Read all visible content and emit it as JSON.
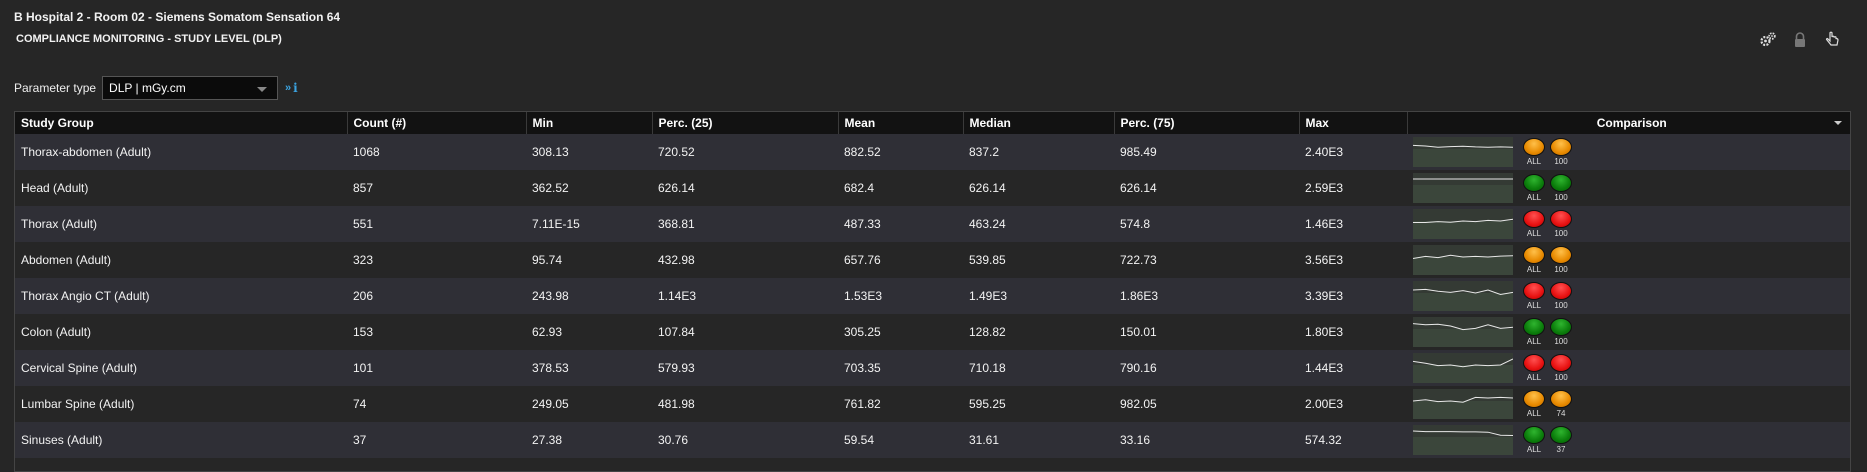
{
  "header": {
    "title": "B Hospital 2 - Room 02 - Siemens Somatom Sensation 64",
    "subtitle": "COMPLIANCE MONITORING - STUDY LEVEL (DLP)"
  },
  "toolbar": {
    "icons": [
      "settings-gears-icon",
      "lock-icon",
      "pointer-hand-icon"
    ]
  },
  "parameter": {
    "label": "Parameter type",
    "selected": "DLP | mGy.cm"
  },
  "table": {
    "columns": [
      "Study Group",
      "Count (#)",
      "Min",
      "Perc. (25)",
      "Mean",
      "Median",
      "Perc. (75)",
      "Max",
      "Comparison"
    ],
    "rows": [
      {
        "group": "Thorax-abdomen (Adult)",
        "count": "1068",
        "min": "308.13",
        "p25": "720.52",
        "mean": "882.52",
        "median": "837.2",
        "p75": "985.49",
        "max": "2.40E3",
        "spark": [
          0.72,
          0.7,
          0.66,
          0.68,
          0.69,
          0.67,
          0.66,
          0.67,
          0.66
        ],
        "lights": [
          {
            "color": "orange",
            "label": "ALL"
          },
          {
            "color": "orange",
            "label": "100"
          }
        ]
      },
      {
        "group": "Head (Adult)",
        "count": "857",
        "min": "362.52",
        "p25": "626.14",
        "mean": "682.4",
        "median": "626.14",
        "p75": "626.14",
        "max": "2.59E3",
        "spark": [
          0.8,
          0.8,
          0.8,
          0.8,
          0.8,
          0.8,
          0.8,
          0.8,
          0.8
        ],
        "lights": [
          {
            "color": "green",
            "label": "ALL"
          },
          {
            "color": "green",
            "label": "100"
          }
        ]
      },
      {
        "group": "Thorax (Adult)",
        "count": "551",
        "min": "7.11E-15",
        "p25": "368.81",
        "mean": "487.33",
        "median": "463.24",
        "p75": "574.8",
        "max": "1.46E3",
        "spark": [
          0.55,
          0.55,
          0.58,
          0.56,
          0.6,
          0.58,
          0.62,
          0.6,
          0.66
        ],
        "lights": [
          {
            "color": "red",
            "label": "ALL"
          },
          {
            "color": "red",
            "label": "100"
          }
        ]
      },
      {
        "group": "Abdomen (Adult)",
        "count": "323",
        "min": "95.74",
        "p25": "432.98",
        "mean": "657.76",
        "median": "539.85",
        "p75": "722.73",
        "max": "3.56E3",
        "spark": [
          0.55,
          0.62,
          0.58,
          0.66,
          0.6,
          0.62,
          0.6,
          0.63,
          0.64
        ],
        "lights": [
          {
            "color": "orange",
            "label": "ALL"
          },
          {
            "color": "orange",
            "label": "100"
          }
        ]
      },
      {
        "group": "Thorax Angio CT (Adult)",
        "count": "206",
        "min": "243.98",
        "p25": "1.14E3",
        "mean": "1.53E3",
        "median": "1.49E3",
        "p75": "1.86E3",
        "max": "3.39E3",
        "spark": [
          0.7,
          0.72,
          0.66,
          0.62,
          0.68,
          0.6,
          0.7,
          0.55,
          0.62
        ],
        "lights": [
          {
            "color": "red",
            "label": "ALL"
          },
          {
            "color": "red",
            "label": "100"
          }
        ]
      },
      {
        "group": "Colon (Adult)",
        "count": "153",
        "min": "62.93",
        "p25": "107.84",
        "mean": "305.25",
        "median": "128.82",
        "p75": "150.01",
        "max": "1.80E3",
        "spark": [
          0.78,
          0.74,
          0.76,
          0.7,
          0.58,
          0.62,
          0.74,
          0.62,
          0.66
        ],
        "lights": [
          {
            "color": "green",
            "label": "ALL"
          },
          {
            "color": "green",
            "label": "100"
          }
        ]
      },
      {
        "group": "Cervical Spine (Adult)",
        "count": "101",
        "min": "378.53",
        "p25": "579.93",
        "mean": "703.35",
        "median": "710.18",
        "p75": "790.16",
        "max": "1.44E3",
        "spark": [
          0.72,
          0.66,
          0.58,
          0.6,
          0.54,
          0.6,
          0.58,
          0.6,
          0.8
        ],
        "lights": [
          {
            "color": "red",
            "label": "ALL"
          },
          {
            "color": "red",
            "label": "100"
          }
        ]
      },
      {
        "group": "Lumbar Spine (Adult)",
        "count": "74",
        "min": "249.05",
        "p25": "481.98",
        "mean": "761.82",
        "median": "595.25",
        "p75": "982.05",
        "max": "2.00E3",
        "spark": [
          0.6,
          0.64,
          0.58,
          0.6,
          0.56,
          0.72,
          0.7,
          0.72,
          0.7
        ],
        "lights": [
          {
            "color": "orange",
            "label": "ALL"
          },
          {
            "color": "orange",
            "label": "74"
          }
        ]
      },
      {
        "group": "Sinuses (Adult)",
        "count": "37",
        "min": "27.38",
        "p25": "30.76",
        "mean": "59.54",
        "median": "31.61",
        "p75": "33.16",
        "max": "574.32",
        "spark": [
          0.8,
          0.78,
          0.78,
          0.78,
          0.77,
          0.77,
          0.76,
          0.66,
          0.65
        ],
        "lights": [
          {
            "color": "green",
            "label": "ALL"
          },
          {
            "color": "green",
            "label": "37"
          }
        ]
      }
    ]
  }
}
